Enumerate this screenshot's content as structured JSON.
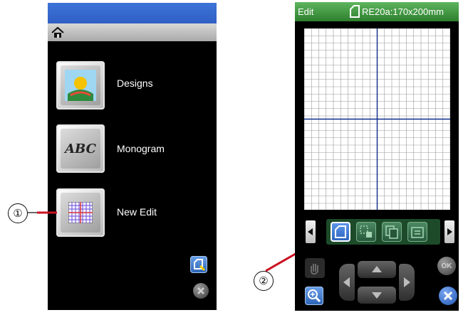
{
  "left_screen": {
    "menu": [
      {
        "label": "Designs",
        "icon": "designs-icon"
      },
      {
        "label": "Monogram",
        "icon": "monogram-icon",
        "icon_text": "ABC"
      },
      {
        "label": "New Edit",
        "icon": "grid-icon"
      }
    ],
    "icons": {
      "home": "home-icon",
      "bottom_button": "edit-tool-icon",
      "close_button": "close-icon"
    }
  },
  "right_screen": {
    "header": {
      "title": "Edit",
      "hoop_label": "RE20a:170x200mm"
    },
    "toolbar": {
      "tools": [
        "frame-icon",
        "select-icon",
        "copy-icon",
        "group-icon"
      ]
    },
    "controls": {
      "ok_label": "OK"
    }
  },
  "callouts": {
    "left": "①",
    "right": "②"
  },
  "colors": {
    "left_topbar": "#3d73d8",
    "right_header": "#2d7f2d",
    "grid_line": "#9a9a9a",
    "grid_axis": "#0c2c8c",
    "callout_line": "#cc1122"
  }
}
